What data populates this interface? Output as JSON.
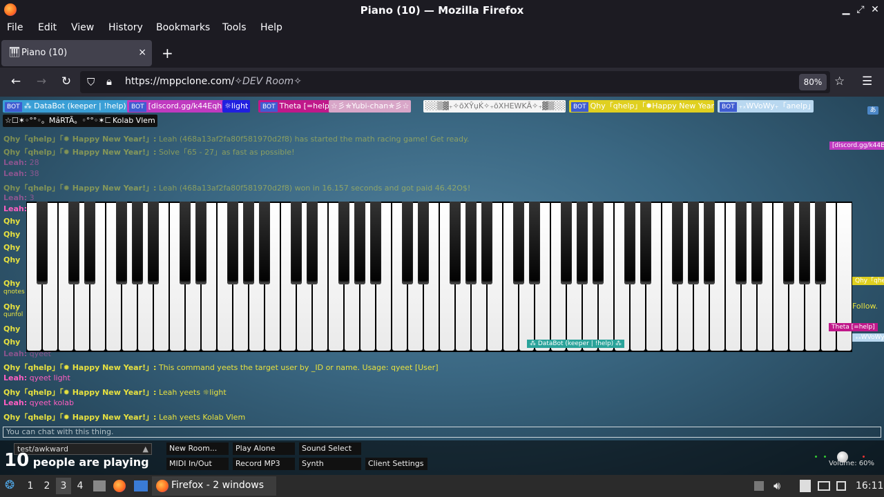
{
  "window": {
    "title": "Piano (10) — Mozilla Firefox"
  },
  "menu": [
    "File",
    "Edit",
    "View",
    "History",
    "Bookmarks",
    "Tools",
    "Help"
  ],
  "tab": {
    "label": "Piano (10)",
    "close": "×",
    "new": "+"
  },
  "url": {
    "host": "https://mppclone.com/",
    "rest": "✧DEV Room✧",
    "zoom": "80%"
  },
  "users": [
    {
      "label": "⁂ DataBot (keeper | !help) ⁂",
      "bot": "BOT",
      "color": "#3a9fd6",
      "fg": "#ffffff"
    },
    {
      "label": "[discord.gg/k44Eqha]",
      "bot": "BOT",
      "color": "#c03ac0",
      "fg": "#ffffff"
    },
    {
      "label": "☼light",
      "bot": "",
      "color": "#2020e0",
      "fg": "#ffffff"
    },
    {
      "label": "Theta [=help]",
      "bot": "BOT",
      "color": "#c0188a",
      "fg": "#ffffff"
    },
    {
      "label": "☆彡✯Yubi-chan✯彡☆",
      "bot": "",
      "color": "#d8a6c8",
      "fg": "#ffffff"
    },
    {
      "label": "░░▒▓₊✧ōXŶụḰ✧₊ōXHEWKĀ✧₊▓▒░░",
      "bot": "",
      "color": "#f5f5f5",
      "fg": "#777777"
    },
    {
      "label": "Qhy「qhelp」「✹Happy New Year!」",
      "bot": "BOT",
      "color": "#e0d020",
      "fg": "#ffffff"
    },
    {
      "label": "₊ₓWVoWy₊「anelp」",
      "bot": "BOT",
      "color": "#b9d8f0",
      "fg": "#ffffff"
    },
    {
      "label": "☆☐✶◦°°◦。MảRTÃ。◦°°◦✶☐☆",
      "bot": "",
      "color": "#111111",
      "fg": "#ffffff"
    },
    {
      "label": "Kolab Vlem",
      "bot": "",
      "color": "#111111",
      "fg": "#ffffff"
    }
  ],
  "chat": [
    {
      "name": "Qhy「qhelp」「✹ Happy New Year!」:",
      "msg": "Leah (468a13af2fa80f581970d2f8) has started the math racing game! Get ready.",
      "type": "bot",
      "faded": true
    },
    {
      "name": "Qhy「qhelp」「✹ Happy New Year!」:",
      "msg": "Solve「65 - 27」as fast as possible!",
      "type": "bot",
      "faded": true
    },
    {
      "name": "Leah:",
      "msg": "28",
      "type": "user",
      "faded": true
    },
    {
      "name": "Leah:",
      "msg": "38",
      "type": "user",
      "faded": true
    },
    {
      "name": "Qhy「qhelp」「✹ Happy New Year!」:",
      "msg": "Leah (468a13af2fa80f581970d2f8) won in 16.157 seconds and got paid 46.42O$!",
      "type": "bot",
      "faded": true
    },
    {
      "name": "Leah:",
      "msg": "3",
      "type": "user",
      "faded": true
    },
    {
      "name": "Leah:",
      "msg": "qyeet",
      "type": "user",
      "faded": true
    },
    {
      "name": "Qhy「qhelp」「✹ Happy New Year!」:",
      "msg": "This command yeets the target user by _ID or name. Usage: qyeet [User]",
      "type": "bot",
      "faded": false
    },
    {
      "name": "Leah:",
      "msg": "qyeet light",
      "type": "user",
      "faded": false
    },
    {
      "name": "Qhy「qhelp」「✹ Happy New Year!」:",
      "msg": "Leah yeets ☼light",
      "type": "bot",
      "faded": false
    },
    {
      "name": "Leah:",
      "msg": "qyeet kolab",
      "type": "user",
      "faded": false
    },
    {
      "name": "Qhy「qhelp」「✹ Happy New Year!」:",
      "msg": "Leah yeets Kolab Vlem",
      "type": "bot",
      "faded": false
    }
  ],
  "side_fragments": [
    "Qhy",
    "Leah:",
    "Qhy",
    "Qhy",
    "Qhy",
    "Qhy",
    "qnotes",
    "Qhy",
    "qunfol",
    "Qhy",
    "Qhy",
    "Leah:"
  ],
  "cursors": [
    {
      "label": "[discord.gg/k44Eqh",
      "color": "#c03ac0"
    },
    {
      "label": "⁂ DataBot (keeper | !help) ⁂",
      "color": "#2aa39a"
    },
    {
      "label": "Qhy「qhel",
      "color": "#e0d020"
    },
    {
      "label": "Theta [=help]",
      "color": "#c0188a"
    },
    {
      "label": "₊ₓWVoWy₊",
      "color": "#b9d8f0"
    },
    {
      "label": "Follow.",
      "color": ""
    }
  ],
  "chat_input": {
    "placeholder": "You can chat with this thing."
  },
  "room": {
    "name": "test/awkward",
    "count": "10",
    "count_text": "people are playing"
  },
  "buttons": [
    "New Room...",
    "Play Alone",
    "Sound Select",
    "MIDI In/Out",
    "Record MP3",
    "Synth",
    "Client Settings"
  ],
  "volume": "Volume: 60%",
  "taskbar": {
    "workspaces": [
      "1",
      "2",
      "3",
      "4"
    ],
    "active_workspace": "3",
    "window_label": "Firefox - 2 windows",
    "clock": "16:11"
  }
}
